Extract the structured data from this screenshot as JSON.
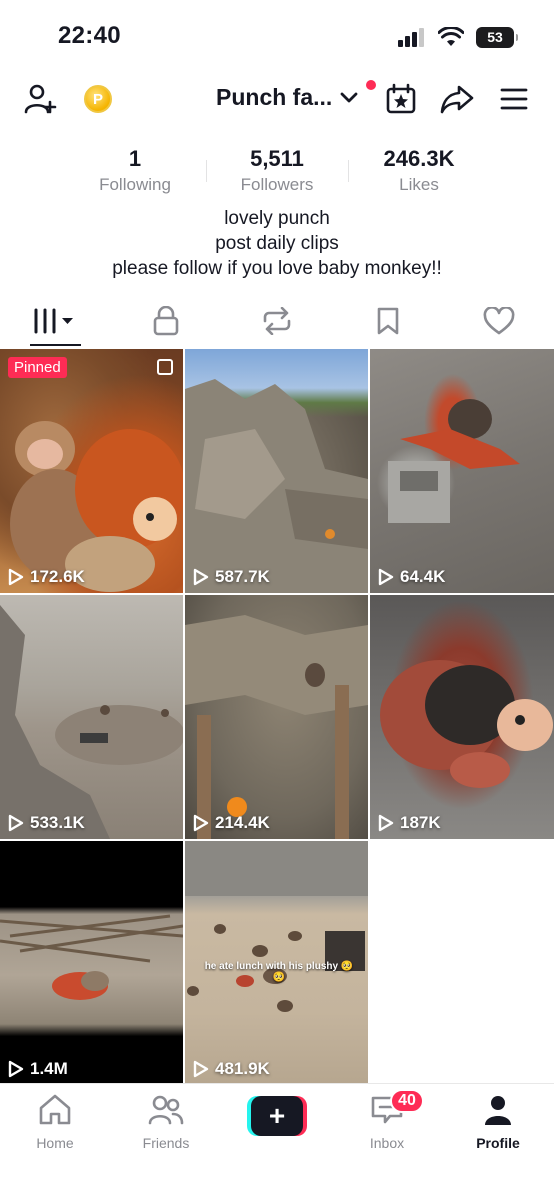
{
  "status_bar": {
    "time": "22:40",
    "battery": "53"
  },
  "header": {
    "profile_name": "Punch fa...",
    "coin_glyph": "P",
    "icons": [
      "add-friend-icon",
      "coin-icon",
      "chevron-down-icon",
      "calendar-star-icon",
      "share-icon",
      "menu-icon"
    ]
  },
  "stats": [
    {
      "value": "1",
      "label": "Following"
    },
    {
      "value": "5,511",
      "label": "Followers"
    },
    {
      "value": "246.3K",
      "label": "Likes"
    }
  ],
  "bio": [
    "lovely punch",
    "post daily clips",
    "please follow if you love baby monkey!!"
  ],
  "tabs": [
    {
      "name": "videos",
      "icon": "grid-icon",
      "active": true
    },
    {
      "name": "private",
      "icon": "lock-icon"
    },
    {
      "name": "reposts",
      "icon": "repost-icon"
    },
    {
      "name": "favorites",
      "icon": "bookmark-icon"
    },
    {
      "name": "liked",
      "icon": "heart-icon"
    }
  ],
  "videos": [
    {
      "views": "172.6K",
      "pinned_label": "Pinned"
    },
    {
      "views": "587.7K"
    },
    {
      "views": "64.4K"
    },
    {
      "views": "533.1K"
    },
    {
      "views": "214.4K"
    },
    {
      "views": "187K"
    },
    {
      "views": "1.4M"
    },
    {
      "views": "481.9K",
      "caption": "he ate lunch with his plushy 🥺🥺"
    }
  ],
  "bottom_nav": {
    "home": "Home",
    "friends": "Friends",
    "create": "+",
    "inbox": "Inbox",
    "inbox_badge": "40",
    "profile": "Profile"
  },
  "colors": {
    "accent": "#fe2c55",
    "cyan": "#25f4ee",
    "text": "#161823",
    "muted": "#8a8b91"
  }
}
